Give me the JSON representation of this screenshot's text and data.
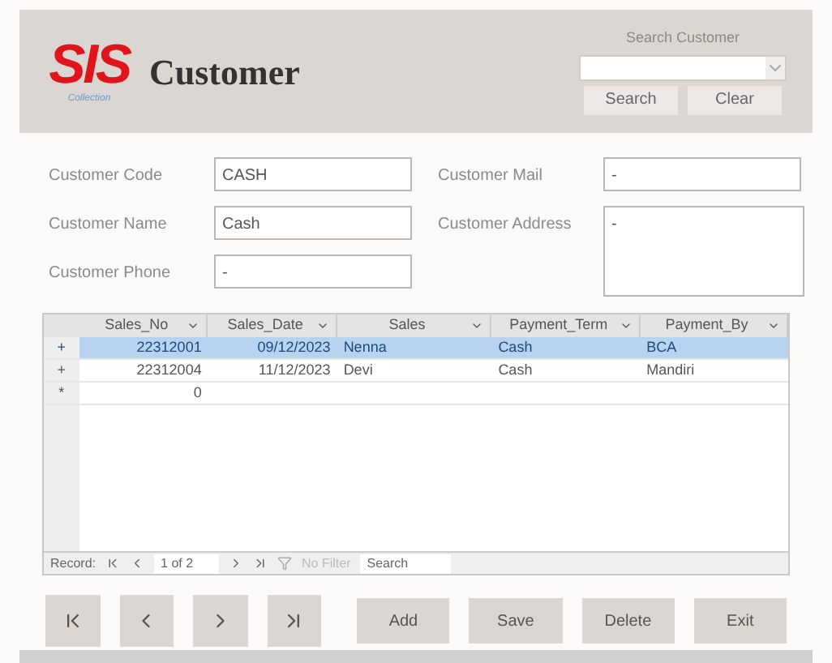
{
  "header": {
    "logo": "SIS",
    "logo_sub": "Collection",
    "title": "Customer",
    "search_label": "Search Customer",
    "search_button": "Search",
    "clear_button": "Clear"
  },
  "fields": [
    {
      "label": "Customer Code",
      "value": "CASH",
      "kind": "line"
    },
    {
      "label": "Customer Name",
      "value": "Cash",
      "kind": "line"
    },
    {
      "label": "Customer Phone",
      "value": "-",
      "kind": "line"
    },
    {
      "label": "Customer Mail",
      "value": "-",
      "kind": "line"
    },
    {
      "label": "Customer Address",
      "value": "-",
      "kind": "area"
    }
  ],
  "table": {
    "columns": [
      "Sales_No",
      "Sales_Date",
      "Sales",
      "Payment_Term",
      "Payment_By"
    ],
    "rows": [
      {
        "marker": "+",
        "cells": [
          "22312001",
          "09/12/2023",
          "Nenna",
          "Cash",
          "BCA"
        ],
        "selected": true
      },
      {
        "marker": "+",
        "cells": [
          "22312004",
          "11/12/2023",
          "Devi",
          "Cash",
          "Mandiri"
        ],
        "selected": false
      },
      {
        "marker": "*",
        "cells": [
          "0",
          "",
          "",
          "",
          ""
        ],
        "selected": false
      }
    ],
    "nav": {
      "label": "Record:",
      "position": "1 of 2",
      "filter": "No Filter",
      "search": "Search"
    }
  },
  "buttons": [
    {
      "kind": "first"
    },
    {
      "kind": "prev"
    },
    {
      "kind": "next"
    },
    {
      "kind": "last"
    },
    {
      "kind": "text",
      "label": "Add"
    },
    {
      "kind": "text",
      "label": "Save"
    },
    {
      "kind": "text",
      "label": "Delete"
    },
    {
      "kind": "text",
      "label": "Exit"
    }
  ]
}
